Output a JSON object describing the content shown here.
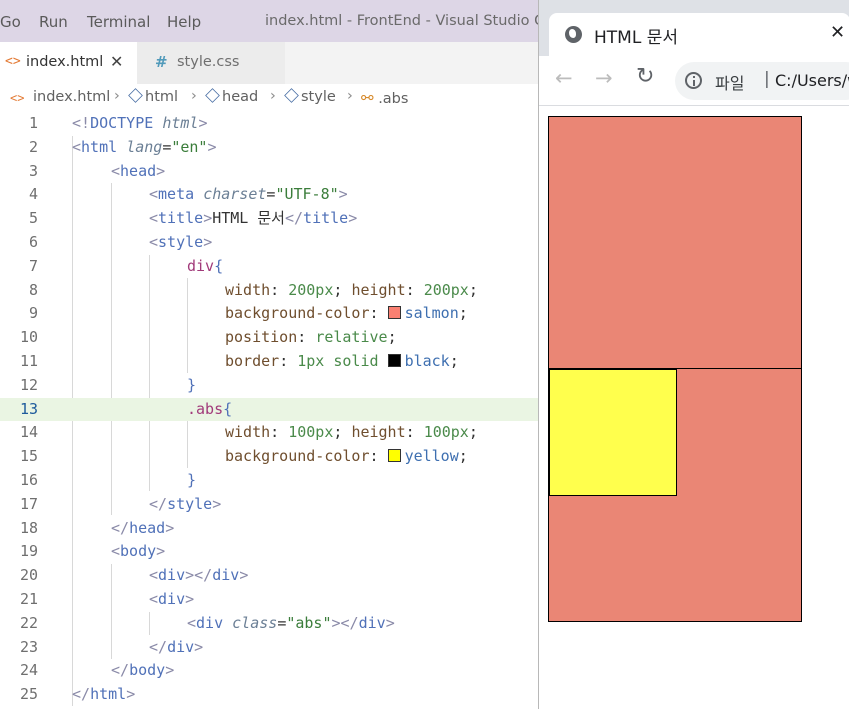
{
  "vscode": {
    "menu": [
      "Go",
      "Run",
      "Terminal",
      "Help"
    ],
    "window_title": "index.html - FrontEnd - Visual Studio Code",
    "tabs": [
      {
        "icon": "<>",
        "label": "index.html",
        "close": "✕"
      },
      {
        "icon": "#",
        "label": "style.css"
      }
    ],
    "breadcrumb": [
      "index.html",
      "html",
      "head",
      "style",
      ".abs"
    ],
    "line_numbers": [
      "1",
      "2",
      "3",
      "4",
      "5",
      "6",
      "7",
      "8",
      "9",
      "10",
      "11",
      "12",
      "13",
      "14",
      "15",
      "16",
      "17",
      "18",
      "19",
      "20",
      "21",
      "22",
      "23",
      "24",
      "25"
    ],
    "code": {
      "l1_open": "<!",
      "l1_doctype": "DOCTYPE",
      "l1_html": "html",
      "l1_close": ">",
      "tag_open": "<",
      "tag_close": ">",
      "end_open": "</",
      "eq": "=",
      "html": "html",
      "lang_attr": "lang",
      "lang_val": "\"en\"",
      "head": "head",
      "meta": "meta",
      "charset_attr": "charset",
      "charset_val": "\"UTF-8\"",
      "title": "title",
      "title_text": "HTML 문서",
      "style": "style",
      "sel_div": "div",
      "sel_abs": ".abs",
      "brace_open": "{",
      "brace_close": "}",
      "width_prop": "width",
      "height_prop": "height",
      "colon": ": ",
      "semi": ";",
      "semi_space": "; ",
      "v200": "200px",
      "v100": "100px",
      "bg_prop": "background-color",
      "salmon": "salmon",
      "yellow": "yellow",
      "position_prop": "position",
      "relative": "relative",
      "border_prop": "border",
      "border_val": "1px solid ",
      "black": "black",
      "body": "body",
      "div": "div",
      "class_attr": "class",
      "class_val": "\"abs\""
    },
    "swatches": {
      "salmon": "#fa8072",
      "black": "#000000",
      "yellow": "#ffff00"
    }
  },
  "browser": {
    "tab_title": "HTML 문서",
    "tab_close": "✕",
    "back": "←",
    "forward": "→",
    "reload": "↻",
    "omnibox_label": "파일",
    "omnibox_sep": "|",
    "url": "C:/Users/w",
    "demo_colors": {
      "outer": "salmon",
      "inner": "yellow",
      "border": "black"
    }
  }
}
